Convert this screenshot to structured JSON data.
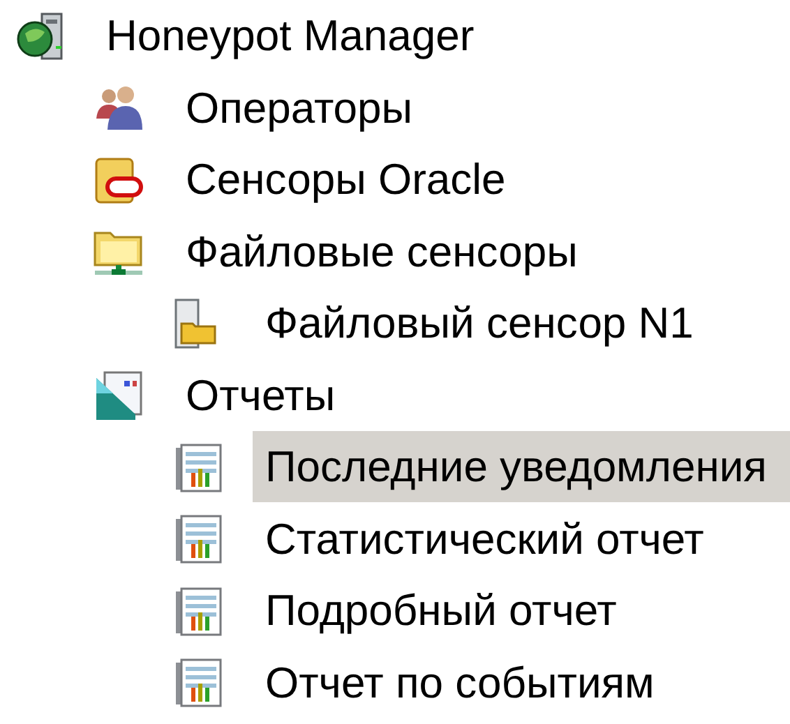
{
  "tree": [
    {
      "label": "Honeypot Manager",
      "kind": "server",
      "selected": false,
      "children": [
        {
          "label": "Операторы",
          "kind": "users",
          "selected": false
        },
        {
          "label": "Сенсоры Oracle",
          "kind": "oracle",
          "selected": false
        },
        {
          "label": "Файловые сенсоры",
          "kind": "netfolder",
          "selected": false,
          "children": [
            {
              "label": "Файловый сенсор N1",
              "kind": "sensor",
              "selected": false
            }
          ]
        },
        {
          "label": "Отчеты",
          "kind": "reports",
          "selected": false,
          "children": [
            {
              "label": "Последние уведомления",
              "kind": "report",
              "selected": true
            },
            {
              "label": "Статистический отчет",
              "kind": "report",
              "selected": false
            },
            {
              "label": "Подробный отчет",
              "kind": "report",
              "selected": false
            },
            {
              "label": "Отчет по событиям",
              "kind": "report",
              "selected": false
            }
          ]
        }
      ]
    }
  ]
}
